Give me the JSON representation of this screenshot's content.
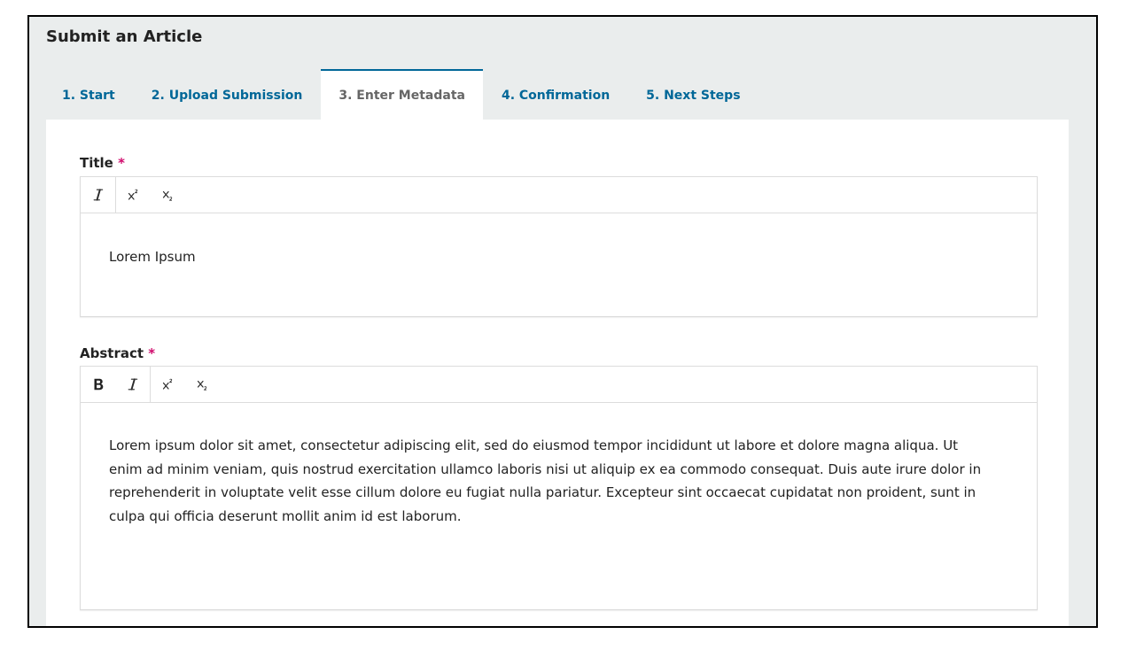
{
  "page": {
    "title": "Submit an Article"
  },
  "tabs": [
    {
      "label": "1. Start",
      "active": false
    },
    {
      "label": "2. Upload Submission",
      "active": false
    },
    {
      "label": "3. Enter Metadata",
      "active": true
    },
    {
      "label": "4. Confirmation",
      "active": false
    },
    {
      "label": "5. Next Steps",
      "active": false
    }
  ],
  "form": {
    "required_marker": "*",
    "title_field": {
      "label": "Title",
      "required": true,
      "toolbar_icons": [
        "italic-icon",
        "superscript-icon",
        "subscript-icon"
      ],
      "value": "Lorem Ipsum"
    },
    "abstract_field": {
      "label": "Abstract",
      "required": true,
      "toolbar_icons": [
        "bold-icon",
        "italic-icon",
        "superscript-icon",
        "subscript-icon"
      ],
      "value": "Lorem ipsum dolor sit amet, consectetur adipiscing elit, sed do eiusmod tempor incididunt ut labore et dolore magna aliqua. Ut enim ad minim veniam, quis nostrud exercitation ullamco laboris nisi ut aliquip ex ea commodo consequat. Duis aute irure dolor in reprehenderit in voluptate velit esse cillum dolore eu fugiat nulla pariatur. Excepteur sint occaecat cupidatat non proident, sunt in culpa qui officia deserunt mollit anim id est laborum."
    }
  },
  "colors": {
    "accent": "#006798",
    "required": "#d00a6c",
    "active_tab_text": "#666666"
  }
}
